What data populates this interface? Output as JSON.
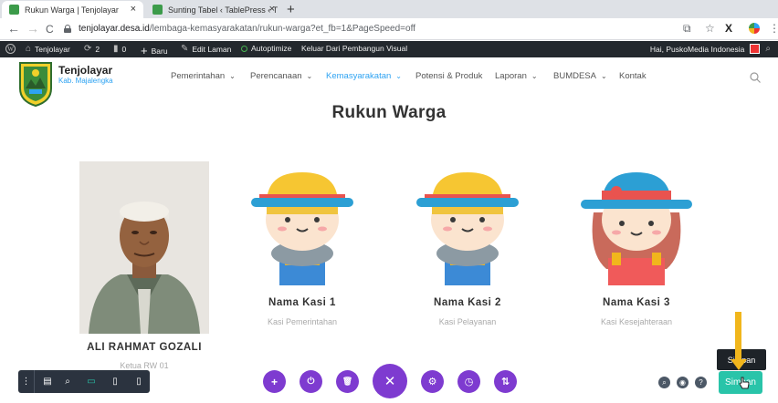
{
  "browser": {
    "tabs": [
      {
        "title": "Rukun Warga | Tenjolayar",
        "active": true
      },
      {
        "title": "Sunting Tabel ‹ TablePress ‹ T",
        "active": false
      }
    ],
    "new_tab_label": "+",
    "close_label": "×",
    "back_label": "←",
    "forward_label": "→",
    "reload_label": "C",
    "url_host": "tenjolayar.desa.id",
    "url_path": "/lembaga-kemasyarakatan/rukun-warga?et_fb=1&PageSpeed=off"
  },
  "wp_admin_bar": {
    "site_name": "Tenjolayar",
    "updates_count": "2",
    "comments_count": "0",
    "new_label": "Baru",
    "edit_label": "Edit Laman",
    "autoptimize_label": "Autoptimize",
    "exit_builder_label": "Keluar Dari Pembangun Visual",
    "greeting": "Hai, PuskoMedia Indonesia"
  },
  "site": {
    "name": "Tenjolayar",
    "subtitle": "Kab. Majalengka",
    "menu": [
      {
        "label": "Pemerintahan",
        "has_dropdown": true,
        "active": false
      },
      {
        "label": "Perencanaan",
        "has_dropdown": true,
        "active": false
      },
      {
        "label": "Kemasyarakatan",
        "has_dropdown": true,
        "active": true
      },
      {
        "label": "Potensi & Produk",
        "has_dropdown": false,
        "active": false
      },
      {
        "label": "Laporan",
        "has_dropdown": true,
        "active": false
      },
      {
        "label": "BUMDESA",
        "has_dropdown": true,
        "active": false
      },
      {
        "label": "Kontak",
        "has_dropdown": false,
        "active": false
      }
    ]
  },
  "page": {
    "title": "Rukun Warga",
    "members": [
      {
        "name": "ALI RAHMAT GOZALI",
        "role": "Ketua RW 01",
        "avatar": "photo"
      },
      {
        "name": "Nama Kasi 1",
        "role": "Kasi Pemerintahan",
        "avatar": "boy-hat-icon"
      },
      {
        "name": "Nama Kasi 2",
        "role": "Kasi Pelayanan",
        "avatar": "boy-hat-icon"
      },
      {
        "name": "Nama Kasi 3",
        "role": "Kasi Kesejahteraan",
        "avatar": "girl-hat-icon"
      }
    ]
  },
  "builder": {
    "left_toolbar_icons": [
      "menu-dots-icon",
      "wireframe-icon",
      "zoom-icon",
      "desktop-icon",
      "tablet-icon",
      "phone-icon"
    ],
    "center_buttons": [
      {
        "icon": "plus-icon",
        "glyph": "+"
      },
      {
        "icon": "power-icon",
        "glyph": "⏻"
      },
      {
        "icon": "trash-icon",
        "glyph": "🗑"
      },
      {
        "icon": "close-icon",
        "glyph": "✕"
      },
      {
        "icon": "settings-icon",
        "glyph": "⚙"
      },
      {
        "icon": "history-icon",
        "glyph": "◷"
      },
      {
        "icon": "sort-icon",
        "glyph": "⇅"
      }
    ],
    "save_label": "Simpan",
    "tooltip_label": "Simpan"
  },
  "colors": {
    "accent_blue": "#2ea3f2",
    "builder_purple": "#7e3bd0",
    "save_green": "#29c4a9",
    "wp_bar": "#23282d",
    "annotation_arrow": "#f1b61c"
  }
}
